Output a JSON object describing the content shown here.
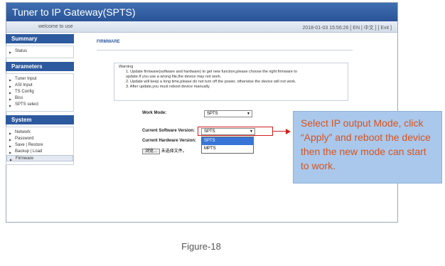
{
  "app": {
    "title": "Tuner to IP Gateway(SPTS)",
    "welcome": "welcome to use",
    "datetime": "2018-01-03 15:56:26",
    "links": "[ EN | 中文 ]   [ Exit ]"
  },
  "sidebar": {
    "summary_heading": "Summary",
    "summary_items": [
      "Status"
    ],
    "parameters_heading": "Parameters",
    "parameters_items": [
      "Tuner Input",
      "ASI Input",
      "TS Config",
      "Biss",
      "SPTS select"
    ],
    "system_heading": "System",
    "system_items": [
      "Network",
      "Password",
      "Save | Restore",
      "Backup | Load",
      "Firmware"
    ]
  },
  "main": {
    "section_title": "FIRMWARE",
    "warning_title": "Warning",
    "warning_lines": [
      "1. Update firmware(software and hardware) to get new function,please choose the right firmware to",
      "update.If you use a wrong file,the device may not work.",
      "2. Update will keep a long time,please do not turn off the power, otherwise the device will not work.",
      "3. After update,you must reboot device manually."
    ],
    "work_mode_label": "Work Mode:",
    "work_mode_value": "SPTS",
    "software_version_label": "Current Software Version:",
    "software_version_value": "SPTS",
    "hardware_version_label": "Current Hardware Version:",
    "dropdown_options": [
      "SPTS",
      "MPTS"
    ],
    "browse_button": "浏览...",
    "browse_text": "未选择文件。"
  },
  "callout": {
    "text": "Select IP output Mode, click “Apply” and reboot the device then the new mode can start to work."
  },
  "caption": "Figure-18"
}
